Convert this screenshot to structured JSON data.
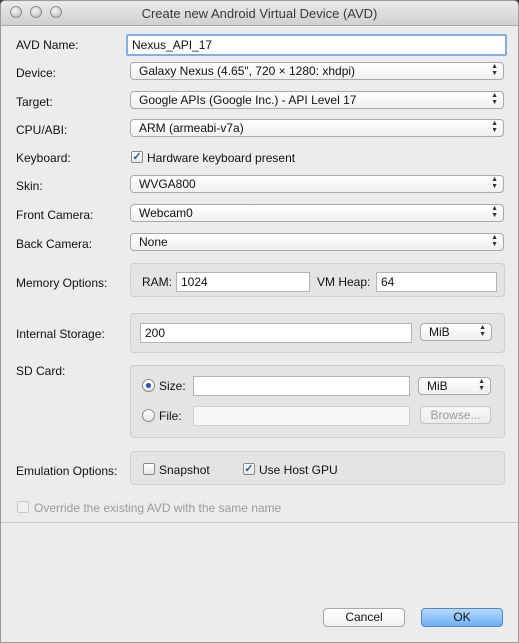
{
  "window": {
    "title": "Create new Android Virtual Device (AVD)"
  },
  "labels": {
    "avd_name": "AVD Name:",
    "device": "Device:",
    "target": "Target:",
    "cpu_abi": "CPU/ABI:",
    "keyboard": "Keyboard:",
    "skin": "Skin:",
    "front_camera": "Front Camera:",
    "back_camera": "Back Camera:",
    "memory_options": "Memory Options:",
    "internal_storage": "Internal Storage:",
    "sd_card": "SD Card:",
    "emulation_options": "Emulation Options:"
  },
  "fields": {
    "avd_name": "Nexus_API_17",
    "device": "Galaxy Nexus (4.65\", 720 × 1280: xhdpi)",
    "target": "Google APIs (Google Inc.) - API Level 17",
    "cpu_abi": "ARM (armeabi-v7a)",
    "keyboard_label": "Hardware keyboard present",
    "keyboard_checked": true,
    "skin": "WVGA800",
    "front_camera": "Webcam0",
    "back_camera": "None"
  },
  "memory": {
    "ram_label": "RAM:",
    "ram_value": "1024",
    "vm_heap_label": "VM Heap:",
    "vm_heap_value": "64"
  },
  "internal_storage": {
    "value": "200",
    "unit": "MiB"
  },
  "sd_card": {
    "size_label": "Size:",
    "size_value": "",
    "size_unit": "MiB",
    "file_label": "File:",
    "file_value": "",
    "browse_label": "Browse...",
    "selected": "size"
  },
  "emulation": {
    "snapshot_label": "Snapshot",
    "snapshot_checked": false,
    "host_gpu_label": "Use Host GPU",
    "host_gpu_checked": true
  },
  "override": {
    "label": "Override the existing AVD with the same name",
    "checked": false
  },
  "buttons": {
    "cancel": "Cancel",
    "ok": "OK"
  },
  "check_glyph": "✓",
  "arrow_up": "▲",
  "arrow_down": "▼"
}
